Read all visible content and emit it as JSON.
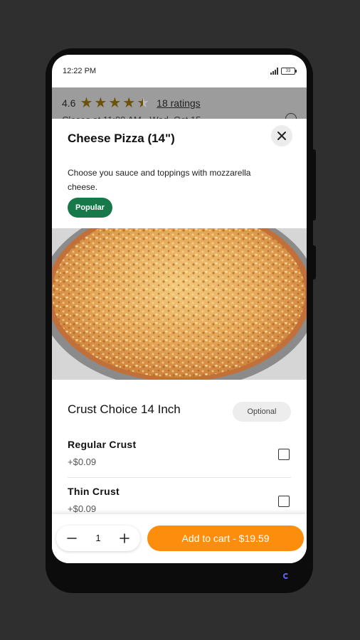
{
  "status": {
    "time": "12:22 PM",
    "battery": "33"
  },
  "restaurant": {
    "rating": "4.6",
    "stars": 4.5,
    "ratings_link": "18 ratings",
    "hours_peek": "Closes at 11:00 AM · Wed, Oct 15"
  },
  "item": {
    "title": "Cheese Pizza (14\")",
    "description": "Choose you sauce and toppings with mozzarella cheese.",
    "badge": "Popular",
    "image_icon": "pizza-photo"
  },
  "options": {
    "group_title": "Crust Choice 14 Inch",
    "group_badge": "Optional",
    "items": [
      {
        "name": "Regular Crust",
        "price": "+$0.09",
        "checked": false
      },
      {
        "name": "Thin Crust",
        "price": "+$0.09",
        "checked": false
      }
    ]
  },
  "cart": {
    "quantity": "1",
    "add_label": "Add to cart - $19.59"
  },
  "colors": {
    "accent": "#fd8e0d",
    "badge_green": "#17794a",
    "star": "#6d5208"
  }
}
